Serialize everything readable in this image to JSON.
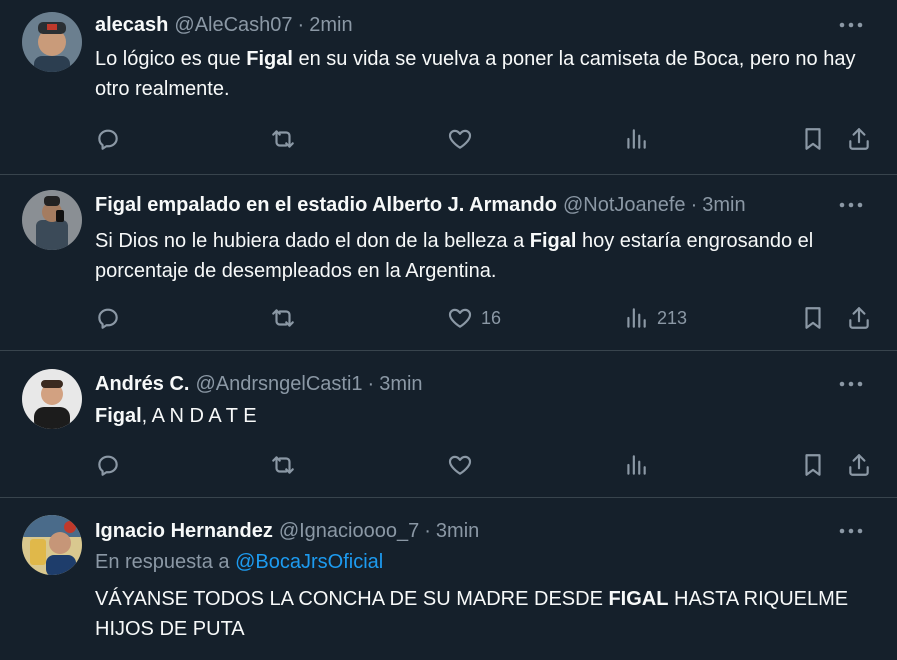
{
  "tweets": [
    {
      "name": "alecash",
      "handle": "@AleCash07",
      "time": "2min",
      "text_parts": [
        "Lo lógico es que ",
        "Figal",
        " en su vida se vuelva a poner la camiseta de Boca, pero no hay otro realmente."
      ],
      "likes": "",
      "views": ""
    },
    {
      "name": "Figal empalado en el estadio Alberto J. Armando",
      "handle": "@NotJoanefe",
      "time": "3min",
      "text_parts": [
        "Si Dios no le hubiera dado el don de la belleza a ",
        "Figal",
        " hoy estaría engrosando el porcentaje de desempleados en la Argentina."
      ],
      "likes": "16",
      "views": "213"
    },
    {
      "name": "Andrés C.",
      "handle": "@AndrsngelCasti1",
      "time": "3min",
      "text_parts": [
        "Figal",
        ", A N D A T E"
      ],
      "likes": "",
      "views": ""
    },
    {
      "name": "Ignacio Hernandez",
      "handle": "@Ignacioooo_7",
      "time": "3min",
      "reply_prefix": "En respuesta a ",
      "reply_handle": "@BocaJrsOficial",
      "text_parts": [
        "VÁYANSE TODOS LA CONCHA DE SU MADRE DESDE ",
        "FIGAL",
        " HASTA RIQUELME HIJOS DE PUTA"
      ]
    }
  ],
  "separator": "·",
  "more_glyph": "•••"
}
